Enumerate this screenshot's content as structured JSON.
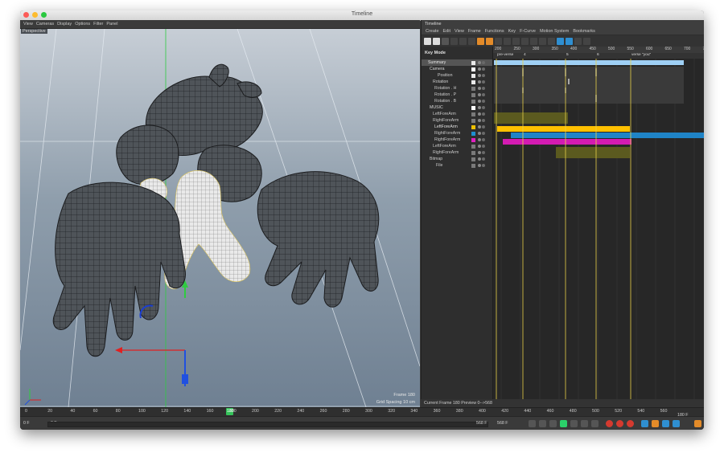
{
  "window": {
    "title": "Timeline"
  },
  "viewport": {
    "menu": [
      "View",
      "Cameras",
      "Display",
      "Options",
      "Filter",
      "Panel"
    ],
    "camera_label": "Perspective",
    "frame_label": "Frame",
    "frame_value": "180",
    "grid_label": "Grid Spacing",
    "grid_value": "10 cm"
  },
  "timeline": {
    "title": "Timeline",
    "menu": [
      "Create",
      "Edit",
      "View",
      "Frame",
      "Functions",
      "Key",
      "F-Curve",
      "Motion System",
      "Bookmarks"
    ],
    "key_mode": "Key Mode",
    "ruler": [
      "200",
      "250",
      "300",
      "350",
      "400",
      "450",
      "500",
      "550",
      "600",
      "650",
      "700",
      "750"
    ],
    "markers": [
      "pre-verse",
      "4",
      "5",
      "6",
      "verse \"you\""
    ],
    "tree": [
      {
        "label": "Summary",
        "indent": 2,
        "color": "#f0a800",
        "text": "#e8e8e8",
        "sq": "#eaeaea"
      },
      {
        "label": "Camera",
        "indent": 4,
        "color": "",
        "text": "#d8d8d8",
        "sq": "#ffffff"
      },
      {
        "label": "Position",
        "indent": 14,
        "color": "",
        "text": "#cfcfcf",
        "sq": "#eaeaea"
      },
      {
        "label": "Rotation",
        "indent": 8,
        "color": "",
        "text": "#cfcfcf",
        "sq": "#eaeaea"
      },
      {
        "label": "Rotation . H",
        "indent": 10,
        "color": "",
        "text": "#c9c9c9",
        "sq": "#7a7a7a"
      },
      {
        "label": "Rotation . P",
        "indent": 10,
        "color": "",
        "text": "#c9c9c9",
        "sq": "#7a7a7a"
      },
      {
        "label": "Rotation . B",
        "indent": 10,
        "color": "",
        "text": "#c9c9c9",
        "sq": "#7a7a7a"
      },
      {
        "label": "MUSIC",
        "indent": 4,
        "color": "",
        "text": "#d8d8d8",
        "sq": "#ffffff"
      },
      {
        "label": "LeftForeArm",
        "indent": 8,
        "color": "",
        "text": "#c9c9c9",
        "sq": "#7a7a7a"
      },
      {
        "label": "RightForeArm",
        "indent": 8,
        "color": "",
        "text": "#c9c9c9",
        "sq": "#7a7a7a"
      },
      {
        "label": "LeftForeArm",
        "indent": 10,
        "color": "",
        "text": "#e0e0e0",
        "sq": "#f0c000"
      },
      {
        "label": "RightForeArm",
        "indent": 10,
        "color": "",
        "text": "#c9c9c9",
        "sq": "#1f8fd0"
      },
      {
        "label": "RightForeArm",
        "indent": 10,
        "color": "",
        "text": "#c9c9c9",
        "sq": "#e020c0"
      },
      {
        "label": "LeftForeArm",
        "indent": 8,
        "color": "",
        "text": "#c9c9c9",
        "sq": "#7a7a7a"
      },
      {
        "label": "RightForeArm",
        "indent": 8,
        "color": "",
        "text": "#c9c9c9",
        "sq": "#7a7a7a"
      },
      {
        "label": "Bitmap",
        "indent": 4,
        "color": "",
        "text": "#c9c9c9",
        "sq": "#7a7a7a"
      },
      {
        "label": "File",
        "indent": 12,
        "color": "",
        "text": "#c9c9c9",
        "sq": "#7a7a7a"
      }
    ],
    "status": "Current Frame  180  Preview  0-->568"
  },
  "bottom": {
    "ruler": [
      "0",
      "20",
      "40",
      "60",
      "80",
      "100",
      "120",
      "140",
      "160",
      "180",
      "200",
      "220",
      "240",
      "260",
      "280",
      "300",
      "320",
      "340",
      "360",
      "380",
      "400",
      "420",
      "440",
      "460",
      "480",
      "500",
      "520",
      "540",
      "560"
    ],
    "current_frame": "180",
    "start": "0 F",
    "start2": "0 F",
    "end": "568 F",
    "end2": "568 F",
    "right_frame": "180 F"
  }
}
